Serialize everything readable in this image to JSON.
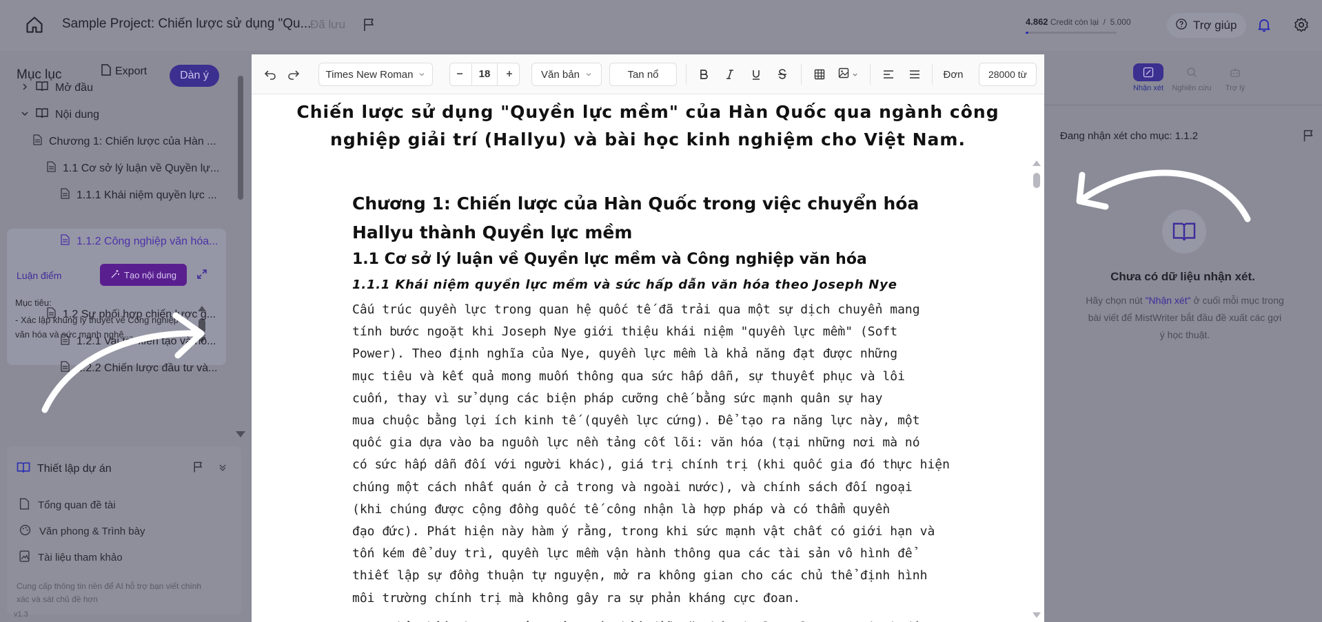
{
  "topbar": {
    "project_title": "Sample Project: Chiến lược sử dụng \"Qu...",
    "saved_status": "Đã lưu",
    "credits_value": "4.862",
    "credits_label": "Credit còn lại",
    "credits_sep": "/",
    "credits_total": "5.000",
    "credits_fraction": 0.028,
    "help_label": "Trợ giúp"
  },
  "sidebar": {
    "toc_title": "Mục lục",
    "export_label": "Export",
    "outline_label": "Dàn ý",
    "items": [
      {
        "label": "Mở đầu"
      },
      {
        "label": "Nội dung"
      },
      {
        "label": "Chương 1: Chiến lược của Hàn ..."
      },
      {
        "label": "1.1 Cơ sở lý luận về Quyền lự..."
      },
      {
        "label": "1.1.1 Khái niệm quyền lực ..."
      },
      {
        "label": "1.1.2 Công nghiệp văn hóa..."
      },
      {
        "label": "1.2 Sự phối hợp chiến lược g..."
      },
      {
        "label": "1.2.1 Vai trò kiến tạo và hỗ..."
      },
      {
        "label": "1.2.2 Chiến lược đầu tư và..."
      }
    ],
    "argument_label": "Luận điểm",
    "generate_label": "Tạo nội dung",
    "goal_heading": "Mục tiêu:",
    "goal_text": "- Xác lập khung lý thuyết về Công nghiệp văn hóa và sức mạnh nghệ..."
  },
  "setup": {
    "title": "Thiết lập dự án",
    "items": [
      {
        "label": "Tổng quan đề tài"
      },
      {
        "label": "Văn phong & Trình bày"
      },
      {
        "label": "Tài liệu tham khảo"
      }
    ],
    "note": "Cung cấp thông tin nền để AI hỗ trợ bạn viết chính xác và sát chủ đề hơn",
    "version": "v1.3"
  },
  "toolbar": {
    "font_family": "Times New Roman",
    "font_size": "18",
    "style": "Văn bản",
    "alignment_mode": "Tan nổ",
    "spacing_label": "Đơn",
    "word_limit": "28000 từ"
  },
  "document": {
    "title": "Chiến lược sử dụng \"Quyền lực mềm\" của Hàn Quốc qua ngành công nghiệp giải trí (Hallyu) và bài học kinh nghiệm cho Việt Nam.",
    "chapter": "Chương 1: Chiến lược của Hàn Quốc trong việc chuyển hóa Hallyu thành Quyền lực mềm",
    "section": "1.1 Cơ sở lý luận về Quyền lực mềm và Công nghiệp văn hóa",
    "subsection": "1.1.1 Khái niệm quyền lực mềm và sức hấp dẫn văn hóa theo Joseph Nye",
    "para_lines": [
      "Cấu trúc quyền lực trong quan hệ quốc tế đã trải qua một sự dịch chuyển mang",
      "tính bước ngoặt khi Joseph Nye giới thiệu khái niệm \"quyền lực mềm\" (Soft",
      "Power). Theo định nghĩa của Nye, quyền lực mềm là khả năng đạt được những",
      "mục tiêu và kết quả mong muốn thông qua sức hấp dẫn, sự thuyết phục và lôi",
      "cuốn, thay vì sử dụng các biện pháp cưỡng chế bằng sức mạnh quân sự hay",
      "mua chuộc bằng lợi ích kinh tế (quyền lực cứng). Để tạo ra năng lực này, một",
      "quốc gia dựa vào ba nguồn lực nền tảng cốt lõi: văn hóa (tại những nơi mà nó",
      "có sức hấp dẫn đối với người khác), giá trị chính trị (khi quốc gia đó thực hiện",
      "chúng một cách nhất quán ở cả trong và ngoài nước), và chính sách đối ngoại",
      "(khi chúng được cộng đồng quốc tế công nhận là hợp pháp và có thẩm quyền",
      "đạo đức). Phát hiện này hàm ý rằng, trong khi sức mạnh vật chất có giới hạn và",
      "tốn kém để duy trì, quyền lực mềm vận hành thông qua các tài sản vô hình để",
      "thiết lập sự đồng thuận tự nguyện, mở ra không gian cho các chủ thể định hình",
      "môi trường chính trị mà không gây ra sự phản kháng cực đoan."
    ],
    "para2_start": "Trong hệ thống ba trụ cột trên, sức hấp dẫn văn hóa (cultural attraction) đóng"
  },
  "right_panel": {
    "tabs": [
      {
        "label": "Nhận xét"
      },
      {
        "label": "Nghiên cứu"
      },
      {
        "label": "Trợ lý"
      }
    ],
    "reviewing_label": "Đang nhận xét cho mục: 1.1.2",
    "empty_title": "Chưa có dữ liệu nhận xét.",
    "empty_text_1": "Hãy chọn nút ",
    "empty_text_hl": "\"Nhận xét\"",
    "empty_text_2": " ở cuối mỗi mục trong bài viết để MistWriter bắt đầu đề xuất các gợi ý học thuật."
  },
  "colors": {
    "accent": "#3b2f8f",
    "overlay_bg": "#8a8b97",
    "editor_bg": "#ffffff"
  }
}
